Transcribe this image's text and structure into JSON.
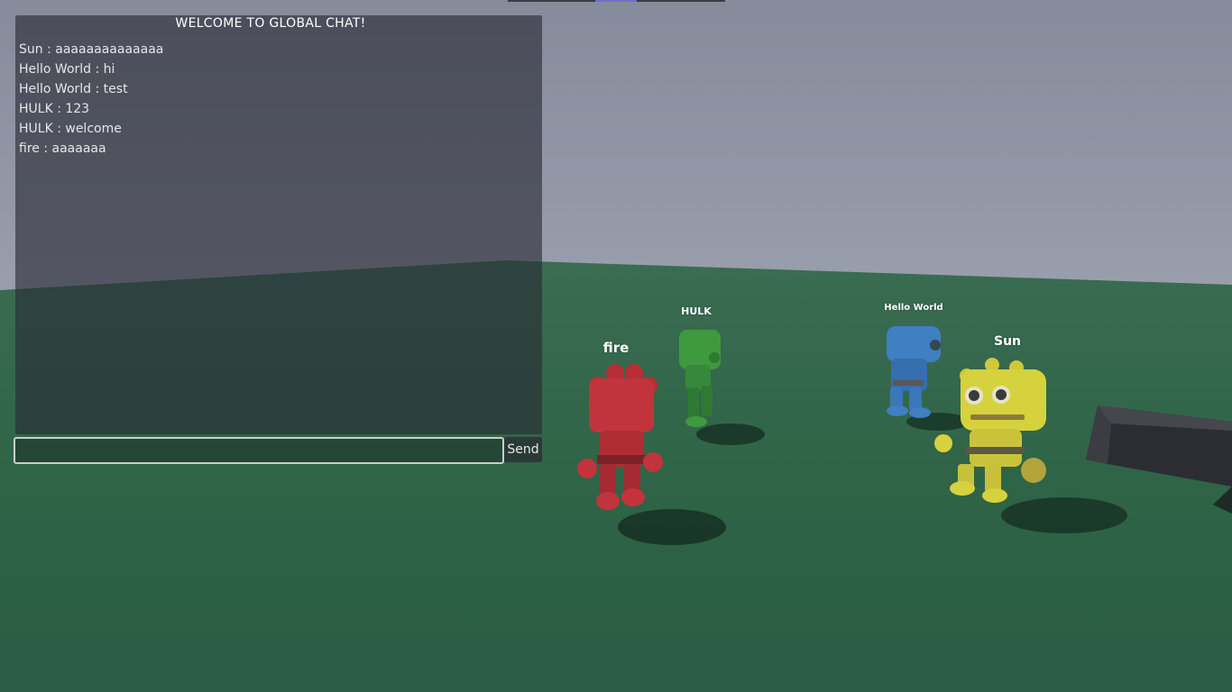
{
  "chat": {
    "title": "WELCOME TO GLOBAL CHAT!",
    "messages": [
      "Sun : aaaaaaaaaaaaaa",
      "Hello World : hi",
      "Hello World : test",
      "HULK : 123",
      "HULK : welcome",
      "fire : aaaaaaa"
    ],
    "input_value": "",
    "send_label": "Send"
  },
  "players": [
    {
      "name": "fire",
      "color": "#c2343b"
    },
    {
      "name": "HULK",
      "color": "#3f9a3d"
    },
    {
      "name": "Hello World",
      "color": "#3f7fc2"
    },
    {
      "name": "Sun",
      "color": "#d6d23e"
    }
  ],
  "colors": {
    "sky": "#848a99",
    "ground": "#2f6447",
    "box": "#34363b"
  }
}
